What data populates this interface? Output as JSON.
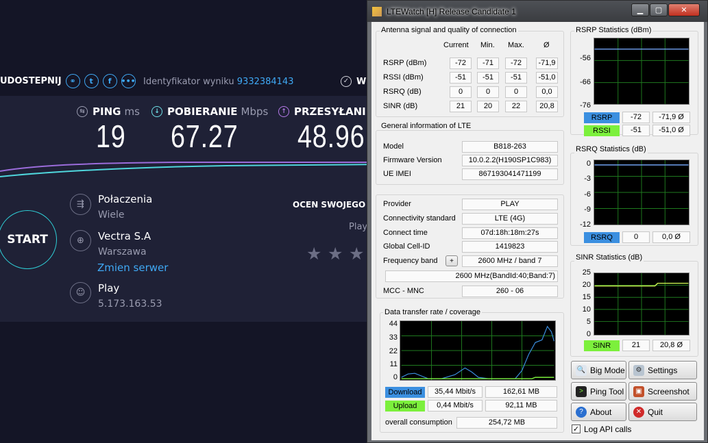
{
  "speedtest": {
    "share_label": "UDOSTEPNIJ",
    "result_id_label": "Identyfikator wyniku",
    "result_id": "9332384143",
    "w_label": "W",
    "ping": {
      "label": "PING",
      "unit": "ms",
      "value": "19"
    },
    "download": {
      "label": "POBIERANIE",
      "unit": "Mbps",
      "value": "67.27"
    },
    "upload": {
      "label": "PRZESYŁANIE",
      "value": "48.96"
    },
    "start_label": "START",
    "connections": {
      "label": "Połaczenia",
      "value": "Wiele"
    },
    "server": {
      "name": "Vectra S.A",
      "city": "Warszawa",
      "change_label": "Zmien serwer"
    },
    "provider": {
      "name": "Play",
      "ip": "5.173.163.53"
    },
    "rate_label": "OCEN SWOJEGO",
    "rate_provider": "Play",
    "rating_stars": 3,
    "colors": {
      "bg": "#141526",
      "panel": "#1f2136",
      "accent": "#3fa9f5",
      "ring": "#2fd0d8"
    }
  },
  "window": {
    "title": "LTEWatch [H]    Release Candidate 1",
    "antenna": {
      "title": "Antenna signal and quality of connection",
      "headers": [
        "Current",
        "Min.",
        "Max.",
        "Ø"
      ],
      "rows": [
        {
          "label": "RSRP (dBm)",
          "values": [
            "-72",
            "-71",
            "-72",
            "-71,9"
          ]
        },
        {
          "label": "RSSI (dBm)",
          "values": [
            "-51",
            "-51",
            "-51",
            "-51,0"
          ]
        },
        {
          "label": "RSRQ (dB)",
          "values": [
            "0",
            "0",
            "0",
            "0,0"
          ]
        },
        {
          "label": "SINR (dB)",
          "values": [
            "21",
            "20",
            "22",
            "20,8"
          ]
        }
      ]
    },
    "general": {
      "title": "General information of LTE",
      "model_label": "Model",
      "model": "B818-263",
      "firmware_label": "Firmware Version",
      "firmware": "10.0.2.2(H190SP1C983)",
      "imei_label": "UE IMEI",
      "imei": "867193041471199"
    },
    "provider": {
      "provider_label": "Provider",
      "provider": "PLAY",
      "standard_label": "Connectivity standard",
      "standard": "LTE (4G)",
      "connect_label": "Connect time",
      "connect": "07d:18h:18m:27s",
      "cell_label": "Global Cell-ID",
      "cell": "1419823",
      "freq_label": "Frequency band",
      "freq_plus": "+",
      "freq": "2600 MHz / band 7",
      "freq_detail": "2600 MHz(BandId:40;Band:7)",
      "mcc_label": "MCC - MNC",
      "mcc": "260 - 06"
    },
    "transfer": {
      "title": "Data transfer rate / coverage",
      "yticks": [
        "44",
        "33",
        "22",
        "11",
        "0"
      ],
      "download_label": "Download",
      "download_rate": "35,44 Mbit/s",
      "download_total": "162,61 MB",
      "upload_label": "Upload",
      "upload_rate": "0,44 Mbit/s",
      "upload_total": "92,11 MB",
      "overall_label": "overall consumption",
      "overall": "254,72 MB"
    },
    "rsrp_stats": {
      "title": "RSRP Statistics (dBm)",
      "yticks": [
        "-56",
        "-66",
        "-76"
      ],
      "rsrp_label": "RSRP",
      "rsrp_cur": "-72",
      "rsrp_avg": "-71,9 Ø",
      "rssi_label": "RSSI",
      "rssi_cur": "-51",
      "rssi_avg": "-51,0 Ø"
    },
    "rsrq_stats": {
      "title": "RSRQ Statistics (dB)",
      "yticks": [
        "0",
        "-3",
        "-6",
        "-9",
        "-12"
      ],
      "label": "RSRQ",
      "cur": "0",
      "avg": "0,0 Ø"
    },
    "sinr_stats": {
      "title": "SINR Statistics (dB)",
      "yticks": [
        "25",
        "20",
        "15",
        "10",
        "5",
        "0"
      ],
      "label": "SINR",
      "cur": "21",
      "avg": "20,8 Ø"
    },
    "buttons": {
      "big_mode": "Big Mode",
      "settings": "Settings",
      "ping_tool": "Ping Tool",
      "screenshot": "Screenshot",
      "about": "About",
      "quit": "Quit"
    },
    "log_api": "Log API calls",
    "colors": {
      "graph_bg": "#000000",
      "grid": "#1f7a1f",
      "download": "#3b8fe0",
      "upload": "#7cf03c",
      "sinr_line": "#c8f050"
    }
  }
}
